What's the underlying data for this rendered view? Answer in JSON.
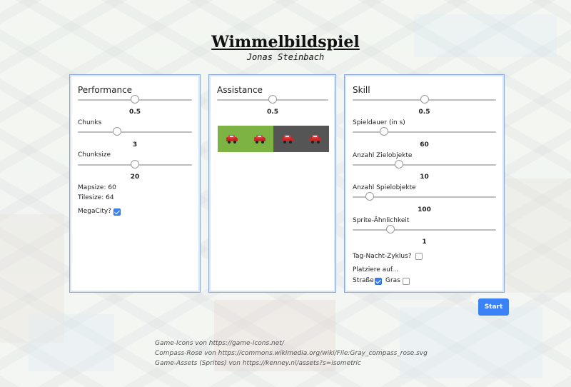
{
  "header": {
    "title": "Wimmelbildspiel",
    "author": "Jonas Steinbach"
  },
  "performance": {
    "title": "Performance",
    "slider1_value": "0.5",
    "chunks_label": "Chunks",
    "chunks_value": "3",
    "chunksize_label": "Chunksize",
    "chunksize_value": "20",
    "mapsize_text": "Mapsize: 60",
    "tilesize_text": "Tilesize: 64",
    "megacity_label": "MegaCity?",
    "megacity_checked": true
  },
  "assistance": {
    "title": "Assistance",
    "slider_value": "0.5",
    "preview_colors": {
      "left": "#7cb342",
      "right": "#555555"
    },
    "preview_icon": "car-icon"
  },
  "skill": {
    "title": "Skill",
    "slider_value": "0.5",
    "duration_label": "Spieldauer (in s)",
    "duration_value": "60",
    "targets_label": "Anzahl Zielobjekte",
    "targets_value": "10",
    "objects_label": "Anzahl Spielobjekte",
    "objects_value": "100",
    "similarity_label": "Sprite-Ähnlichkeit",
    "similarity_value": "1",
    "daynight_label": "Tag-Nacht-Zyklus?",
    "daynight_checked": false,
    "place_label": "Platziere auf...",
    "street_label": "Straße",
    "street_checked": true,
    "grass_label": "Gras",
    "grass_checked": false
  },
  "actions": {
    "start_label": "Start"
  },
  "credits": {
    "line1": "Game-Icons von https://game-icons.net/",
    "line2": "Compass-Rose von https://commons.wikimedia.org/wiki/File:Gray_compass_rose.svg",
    "line3": "Game-Assets (Sprites) von https://kenney.nl/assets?s=isometric"
  },
  "colors": {
    "accent": "#3b82f6",
    "panel_border": "#8aa9d8"
  }
}
